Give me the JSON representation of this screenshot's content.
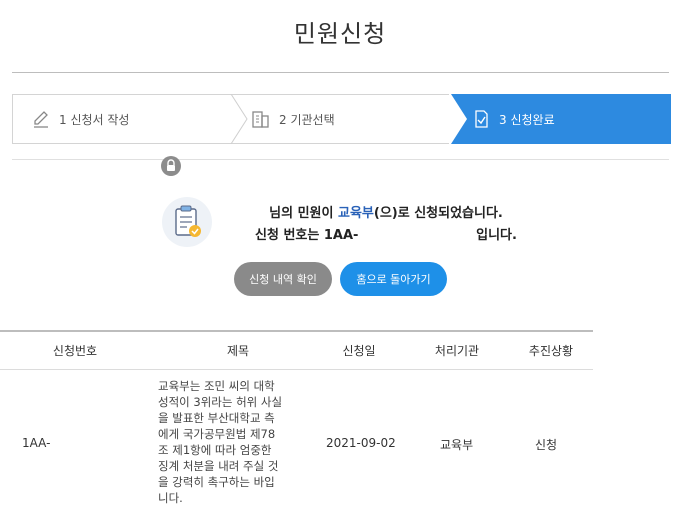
{
  "page": {
    "title": "민원신청"
  },
  "steps": [
    {
      "label": "1 신청서 작성",
      "icon": "pencil-icon",
      "active": false
    },
    {
      "label": "2 기관선택",
      "icon": "building-icon",
      "active": false
    },
    {
      "label": "3 신청완료",
      "icon": "document-check-icon",
      "active": true
    }
  ],
  "result": {
    "icon": "clipboard-check-icon",
    "line1_prefix": "님의 민원이 ",
    "line1_agency": "교육부",
    "line1_suffix": "(으)로 신청되었습니다.",
    "line2_prefix": "신청 번호는 ",
    "line2_number": "1AA-",
    "line2_suffix": "입니다."
  },
  "buttons": {
    "history": "신청 내역 확인",
    "home": "홈으로 돌아가기"
  },
  "table": {
    "headers": [
      "신청번호",
      "제목",
      "신청일",
      "처리기관",
      "추진상황"
    ],
    "rows": [
      {
        "number": "1AA-",
        "title": "교육부는 조민 씨의 대학 성적이 3위라는 허위 사실을 발표한 부산대학교 측에게 국가공무원법 제78조 제1항에 따라 엄중한 징계 처분을 내려 주실 것을 강력히 촉구하는 바입니다.",
        "date": "2021-09-02",
        "agency": "교육부",
        "status": "신청",
        "lock_icon": "lock-icon"
      }
    ]
  },
  "colors": {
    "accent": "#2d8ae0",
    "home_button": "#1e90e8",
    "history_button": "#8a8a8a",
    "agency_text": "#2a62b8"
  }
}
